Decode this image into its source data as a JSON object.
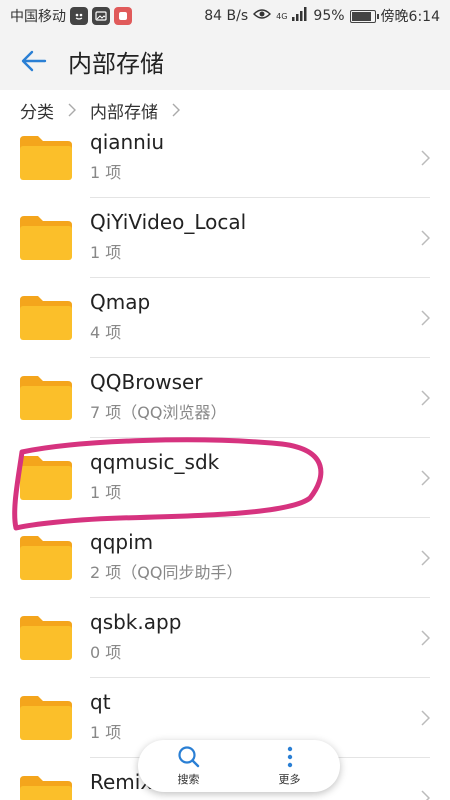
{
  "status_bar": {
    "carrier": "中国移动",
    "speed": "84 B/s",
    "network": "4G",
    "battery": "95%",
    "battery_level": 0.95,
    "time": "傍晚6:14"
  },
  "header": {
    "title": "内部存储",
    "back_icon": "arrow-left-icon"
  },
  "breadcrumb": {
    "items": [
      "分类",
      "内部存储"
    ]
  },
  "files": [
    {
      "name": "qianniu",
      "meta": "1 项"
    },
    {
      "name": "QiYiVideo_Local",
      "meta": "1 项"
    },
    {
      "name": "Qmap",
      "meta": "4 项"
    },
    {
      "name": "QQBrowser",
      "meta": "7 项（QQ浏览器）"
    },
    {
      "name": "qqmusic_sdk",
      "meta": "1 项"
    },
    {
      "name": "qqpim",
      "meta": "2 项（QQ同步助手）"
    },
    {
      "name": "qsbk.app",
      "meta": "0 项"
    },
    {
      "name": "qt",
      "meta": "1 项"
    },
    {
      "name": "Remix",
      "meta": ""
    }
  ],
  "bottom_bar": {
    "search_label": "搜索",
    "more_label": "更多"
  },
  "colors": {
    "accent": "#2a7fd4",
    "folder": "#fbbf2a",
    "folder_tab": "#f4a51c",
    "annotation": "#d6337f"
  }
}
